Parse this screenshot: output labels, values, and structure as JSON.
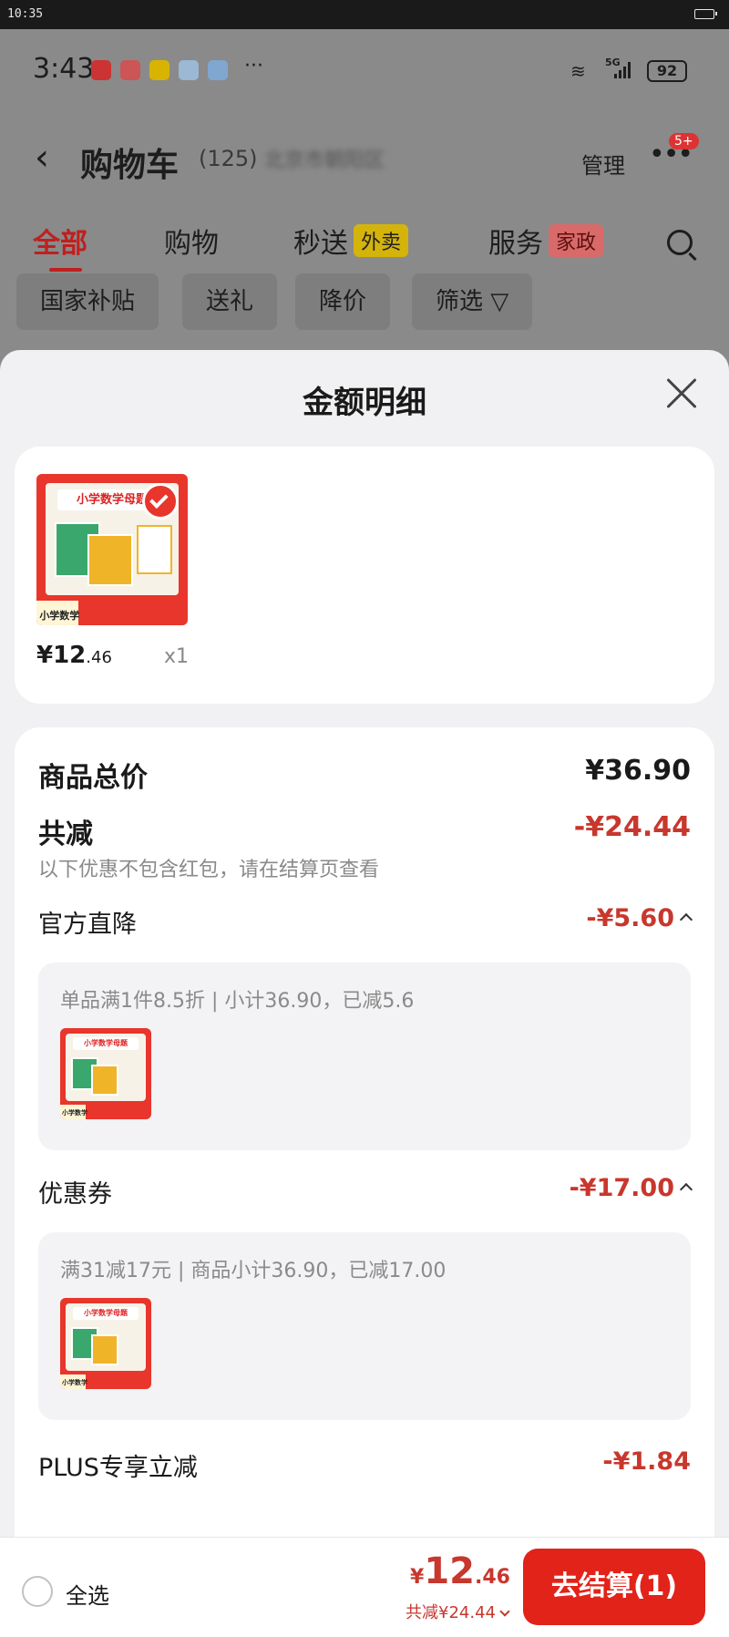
{
  "device": {
    "time": "10:35"
  },
  "background_page": {
    "status": {
      "clock": "3:43",
      "more": "···",
      "network": "5G",
      "battery": "92"
    },
    "nav": {
      "back": "‹",
      "title": "购物车",
      "count": "(125)",
      "address": "北京市朝阳区",
      "manage": "管理",
      "more": "•••",
      "badge": "5+"
    },
    "tabs": [
      {
        "label": "全部"
      },
      {
        "label": "购物"
      },
      {
        "label": "秒送",
        "tag": "外卖"
      },
      {
        "label": "服务",
        "tag": "家政"
      }
    ],
    "chips": [
      "国家补贴",
      "送礼",
      "降价",
      "筛选 ▽"
    ]
  },
  "sheet": {
    "title": "金额明细",
    "product": {
      "thumb_text": "小学数学母题",
      "thumb_label": "小学数学",
      "price_int": "¥12",
      "price_dec": ".46",
      "qty": "x1"
    },
    "summary": {
      "total_label": "商品总价",
      "total_value": "¥36.90",
      "reduce_label": "共减",
      "reduce_value": "-¥24.44",
      "reduce_note": "以下优惠不包含红包，请在结算页查看"
    },
    "discounts": [
      {
        "label": "官方直降",
        "value": "-¥5.60",
        "desc": "单品满1件8.5折 | 小计36.90，已减5.6"
      },
      {
        "label": "优惠券",
        "value": "-¥17.00",
        "desc": "满31减17元 | 商品小计36.90，已减17.00"
      },
      {
        "label": "PLUS专享立减",
        "value": "-¥1.84"
      }
    ]
  },
  "bottom": {
    "select_all": "全选",
    "total_symbol": "¥",
    "total_int": "12",
    "total_dec": ".46",
    "total_reduce": "共减¥24.44",
    "checkout": "去结算(1)"
  },
  "colors": {
    "accent": "#e2231a",
    "discount_red": "#c8372d",
    "sheet_bg": "#f1f1f3",
    "overlay": "#8a8a8a"
  }
}
